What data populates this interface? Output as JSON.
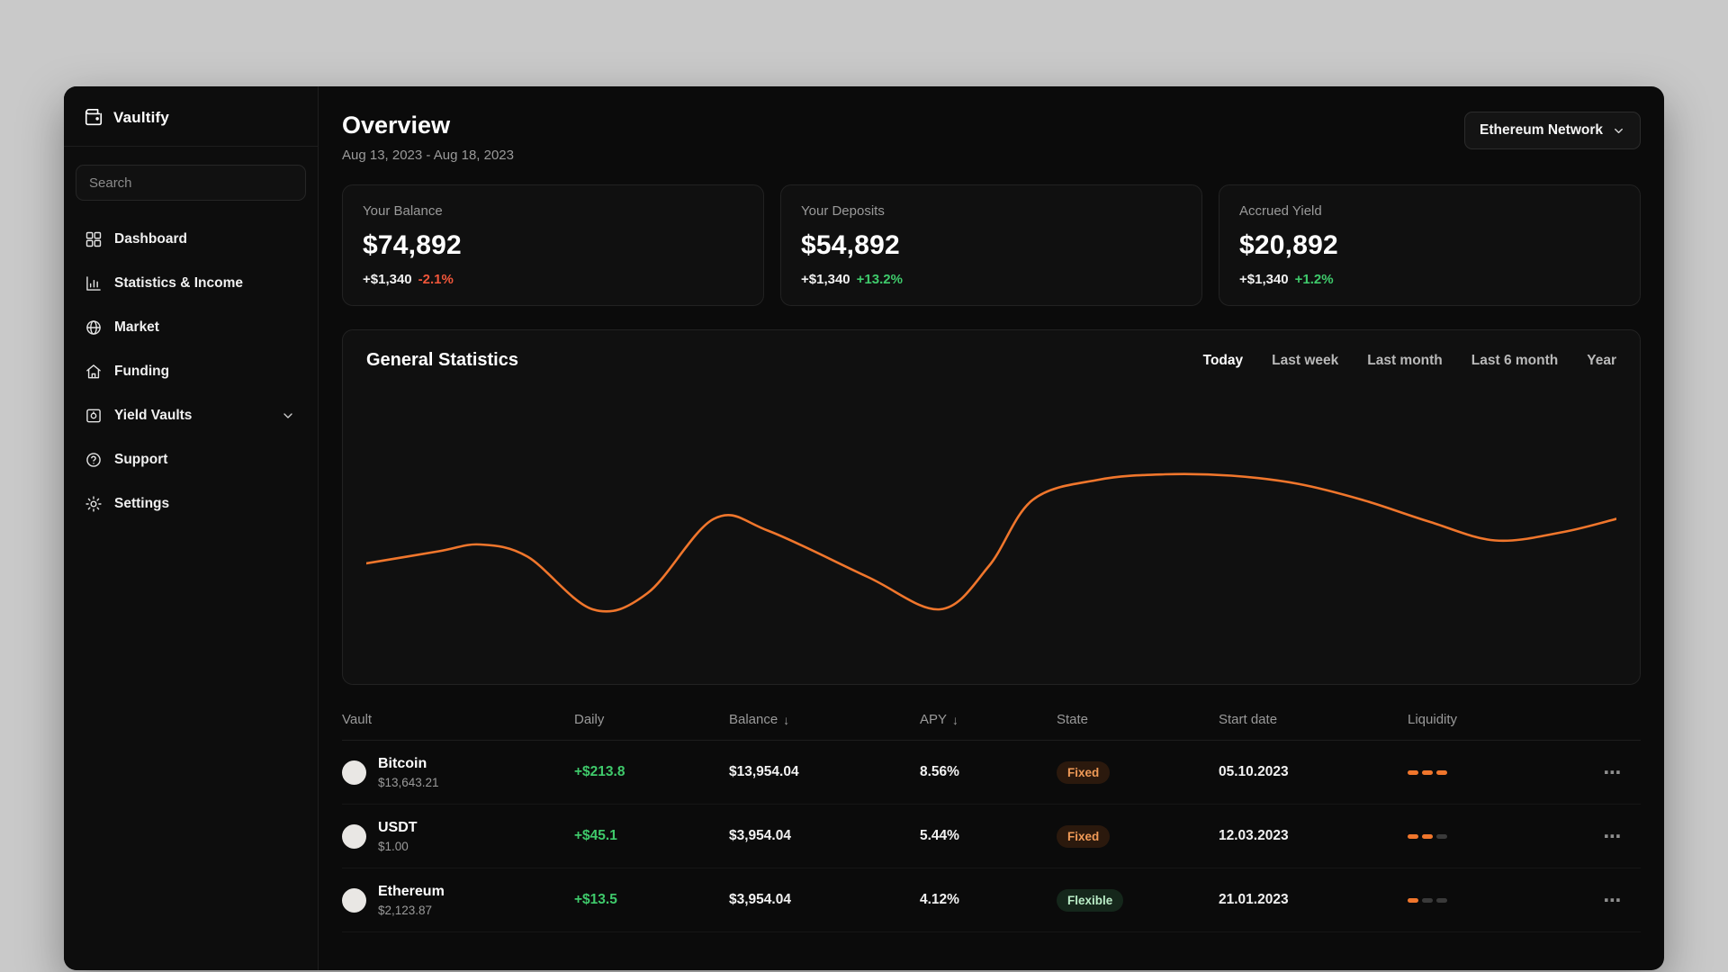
{
  "colors": {
    "accent": "#f0762c",
    "positive": "#3fca6b",
    "negative": "#f0563a"
  },
  "app": {
    "name": "Vaultify"
  },
  "sidebar": {
    "search_placeholder": "Search",
    "items": [
      {
        "label": "Dashboard",
        "icon": "dashboard-grid-icon"
      },
      {
        "label": "Statistics & Income",
        "icon": "bar-chart-icon"
      },
      {
        "label": "Market",
        "icon": "globe-icon"
      },
      {
        "label": "Funding",
        "icon": "home-icon"
      },
      {
        "label": "Yield Vaults",
        "icon": "vault-icon"
      },
      {
        "label": "Support",
        "icon": "help-icon"
      },
      {
        "label": "Settings",
        "icon": "gear-icon"
      }
    ]
  },
  "header": {
    "title": "Overview",
    "date_range": "Aug 13, 2023 - Aug 18, 2023",
    "network_button": "Ethereum Network"
  },
  "stats": [
    {
      "label": "Your Balance",
      "value": "$74,892",
      "change": "+$1,340",
      "pct": "-2.1%",
      "trend": "negative"
    },
    {
      "label": "Your Deposits",
      "value": "$54,892",
      "change": "+$1,340",
      "pct": "+13.2%",
      "trend": "positive"
    },
    {
      "label": "Accrued Yield",
      "value": "$20,892",
      "change": "+$1,340",
      "pct": "+1.2%",
      "trend": "positive"
    }
  ],
  "chart_card": {
    "title": "General Statistics",
    "filters": [
      "Today",
      "Last week",
      "Last month",
      "Last 6 month",
      "Year"
    ],
    "active_filter": "Today"
  },
  "chart_data": {
    "type": "line",
    "title": "General Statistics",
    "legend": [],
    "grid": false,
    "axes_visible": false,
    "color": "#f0762c",
    "x": [
      0,
      5.8,
      9.1,
      12.9,
      18.1,
      22.5,
      27.8,
      32.2,
      40.1,
      45.9,
      49.8,
      53.3,
      58.6,
      63.9,
      69.2,
      74.5,
      79.7,
      85.0,
      90.3,
      95.6,
      100
    ],
    "values": [
      0.34,
      0.43,
      0.48,
      0.39,
      0.0,
      0.12,
      0.67,
      0.58,
      0.24,
      0.0,
      0.32,
      0.81,
      0.96,
      1.0,
      0.99,
      0.93,
      0.81,
      0.65,
      0.51,
      0.57,
      0.67
    ]
  },
  "table": {
    "headers": [
      {
        "label": "Vault",
        "sort": ""
      },
      {
        "label": "Daily",
        "sort": ""
      },
      {
        "label": "Balance",
        "sort": "↓"
      },
      {
        "label": "APY",
        "sort": "↓"
      },
      {
        "label": "State",
        "sort": ""
      },
      {
        "label": "Start date",
        "sort": ""
      },
      {
        "label": "Liquidity",
        "sort": ""
      }
    ],
    "row_menu_glyph": "⋯",
    "rows": [
      {
        "name": "Bitcoin",
        "price": "$13,643.21",
        "daily": "+$213.8",
        "balance": "$13,954.04",
        "apy": "8.56%",
        "state": "Fixed",
        "state_type": "fixed",
        "start_date": "05.10.2023",
        "liquidity": 3
      },
      {
        "name": "USDT",
        "price": "$1.00",
        "daily": "+$45.1",
        "balance": "$3,954.04",
        "apy": "5.44%",
        "state": "Fixed",
        "state_type": "fixed",
        "start_date": "12.03.2023",
        "liquidity": 2
      },
      {
        "name": "Ethereum",
        "price": "$2,123.87",
        "daily": "+$13.5",
        "balance": "$3,954.04",
        "apy": "4.12%",
        "state": "Flexible",
        "state_type": "flexible",
        "start_date": "21.01.2023",
        "liquidity": 1
      }
    ]
  }
}
